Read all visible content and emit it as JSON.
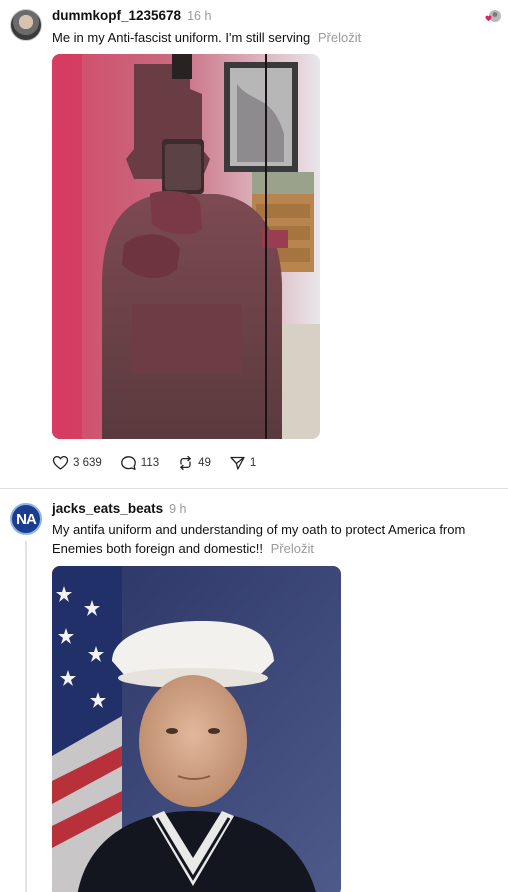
{
  "posts": [
    {
      "username": "dummkopf_1235678",
      "time": "16 h",
      "caption": "Me in my Anti-fascist uniform. I'm still serving",
      "translate_label": "Přeložit",
      "likes": "3 639",
      "comments": "113",
      "reposts": "49",
      "shares": "1"
    },
    {
      "username": "jacks_eats_beats",
      "time": "9 h",
      "avatar_text": "NA",
      "caption": "My antifa uniform and understanding of my oath to protect America from Enemies both foreign and domestic!!",
      "translate_label": "Přeložit"
    }
  ],
  "icons": {
    "like": "heart-icon",
    "comment": "comment-icon",
    "repost": "repost-icon",
    "share": "share-icon"
  },
  "colors": {
    "text": "#111111",
    "muted": "#9a9a9a",
    "divider": "#dedede",
    "heart_red": "#e0245e"
  }
}
